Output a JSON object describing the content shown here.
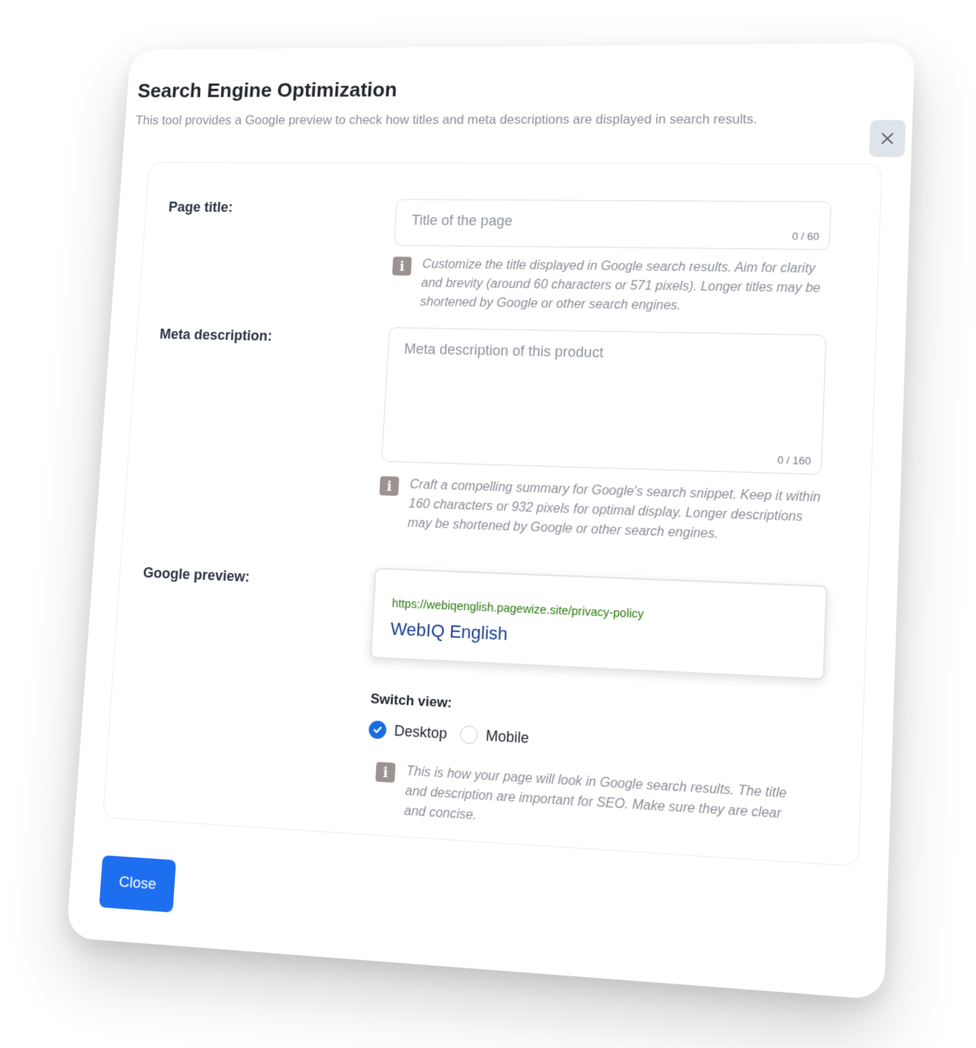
{
  "modal": {
    "title": "Search Engine Optimization",
    "subtitle": "This tool provides a Google preview to check how titles and meta descriptions are displayed in search results.",
    "close_icon": "close-icon"
  },
  "page_title": {
    "label": "Page title:",
    "placeholder": "Title of the page",
    "counter": "0 / 60",
    "help": "Customize the title displayed in Google search results. Aim for clarity and brevity (around 60 characters or 571 pixels). Longer titles may be shortened by Google or other search engines."
  },
  "meta_description": {
    "label": "Meta description:",
    "placeholder": "Meta description of this product",
    "counter": "0 / 160",
    "help": "Craft a compelling summary for Google's search snippet. Keep it within 160 characters or 932 pixels for optimal display. Longer descriptions may be shortened by Google or other search engines."
  },
  "google_preview": {
    "label": "Google preview:",
    "url": "https://webiqenglish.pagewize.site/privacy-policy",
    "title": "WebIQ English"
  },
  "switch_view": {
    "label": "Switch view:",
    "options": [
      {
        "label": "Desktop",
        "selected": true
      },
      {
        "label": "Mobile",
        "selected": false
      }
    ],
    "help": "This is how your page will look in Google search results. The title and description are important for SEO. Make sure they are clear and concise."
  },
  "footer": {
    "close_label": "Close"
  },
  "colors": {
    "accent": "#1e6ff0",
    "url_green": "#2d7a12",
    "title_blue": "#1a3f8f",
    "info_icon": "#9a9390"
  }
}
